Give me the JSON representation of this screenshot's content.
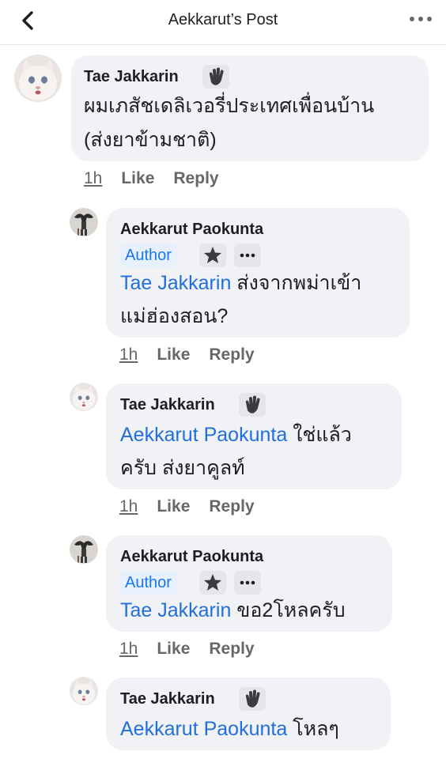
{
  "header": {
    "title": "Aekkarut’s Post"
  },
  "comments": [
    {
      "author": "Tae Jakkarin",
      "lines": [
        "ผมเภสัชเดลิเวอรี่ประเทศเพื่อนบ้าน",
        "(ส่งยาข้ามชาติ)"
      ],
      "time": "1h",
      "like": "Like",
      "reply": "Reply"
    },
    {
      "author": "Aekkarut Paokunta",
      "badge": "Author",
      "mention": "Tae Jakkarin",
      "line1_rest": " ส่งจากพม่าเข้า",
      "line2": "แม่ฮ่องสอน?",
      "time": "1h",
      "like": "Like",
      "reply": "Reply"
    },
    {
      "author": "Tae Jakkarin",
      "mention": "Aekkarut Paokunta",
      "line1_rest": " ใช่แล้ว",
      "line2": "ครับ ส่งยาคูลท์",
      "time": "1h",
      "like": "Like",
      "reply": "Reply"
    },
    {
      "author": "Aekkarut Paokunta",
      "badge": "Author",
      "mention": "Tae Jakkarin",
      "line1_rest": " ขอ2โหลครับ",
      "time": "1h",
      "like": "Like",
      "reply": "Reply"
    },
    {
      "author": "Tae Jakkarin",
      "mention": "Aekkarut Paokunta",
      "line1_rest": " โหลๆ"
    }
  ],
  "icons": {
    "back": "chevron-left-icon",
    "more": "more-dots-icon",
    "wave": "waving-hand-icon",
    "star": "star-badge-icon",
    "dots": "more-dots-icon"
  },
  "colors": {
    "bubble": "#f0f2f5",
    "mention": "#216fdb",
    "author_badge_bg": "#e7f0fd",
    "meta_text": "#65676b"
  }
}
